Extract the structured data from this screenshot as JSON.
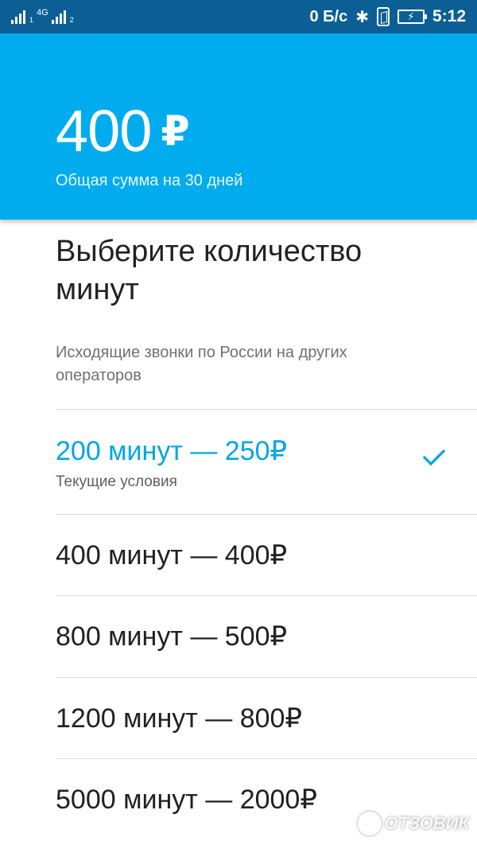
{
  "status_bar": {
    "network_type": "4G",
    "sim1": "1",
    "sim2": "2",
    "net_speed": "0 Б/с",
    "time": "5:12"
  },
  "header": {
    "amount": "400",
    "currency": "₽",
    "caption": "Общая сумма на 30 дней",
    "color": "#00acee"
  },
  "content": {
    "title": "Выберите количество минут",
    "subtitle": "Исходящие звонки по России на других операторов"
  },
  "options": [
    {
      "label": "200 минут — 250₽",
      "note": "Текущие условия",
      "selected": true
    },
    {
      "label": "400 минут — 400₽"
    },
    {
      "label": "800 минут — 500₽"
    },
    {
      "label": "1200 минут — 800₽"
    },
    {
      "label": "5000 минут — 2000₽"
    }
  ],
  "accent_color": "#00a6e6",
  "watermark": "ОТЗОВИК"
}
